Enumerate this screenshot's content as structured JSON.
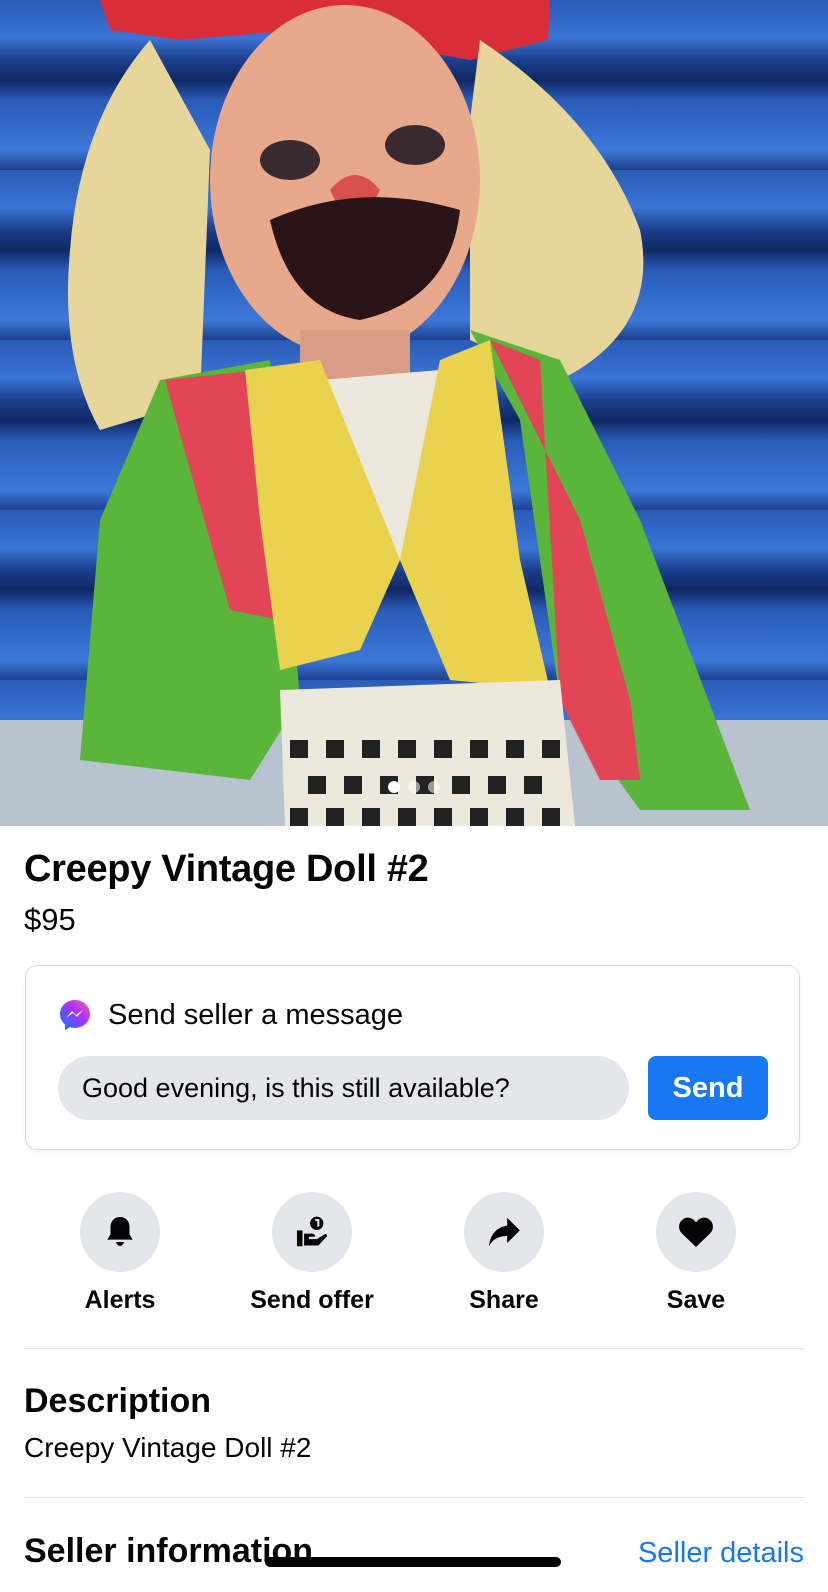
{
  "listing": {
    "title": "Creepy Vintage Doll #2",
    "price": "$95",
    "photo_count": 3,
    "active_photo_index": 0
  },
  "message": {
    "heading": "Send seller a message",
    "input_value": "Good evening, is this still available?",
    "send_label": "Send",
    "icon": "messenger-icon"
  },
  "actions": [
    {
      "label": "Alerts",
      "icon": "bell-icon"
    },
    {
      "label": "Send offer",
      "icon": "offer-icon"
    },
    {
      "label": "Share",
      "icon": "share-icon"
    },
    {
      "label": "Save",
      "icon": "heart-icon"
    }
  ],
  "description": {
    "heading": "Description",
    "text": "Creepy Vintage Doll #2"
  },
  "seller": {
    "heading": "Seller information",
    "details_link": "Seller details"
  },
  "colors": {
    "accent": "#1877f2",
    "chip_bg": "#e4e6eb",
    "text": "#050505"
  }
}
